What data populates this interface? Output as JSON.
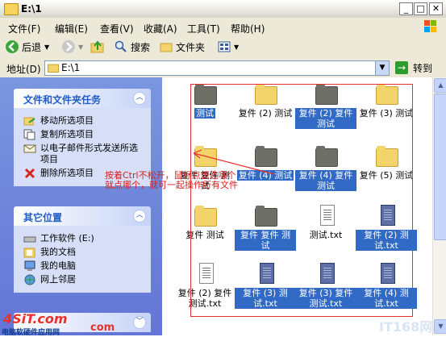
{
  "window": {
    "title": "E:\\1"
  },
  "title_buttons": {
    "minimize": "_",
    "maximize": "□",
    "close": "✕"
  },
  "menubar": {
    "items": [
      "文件(F)",
      "编辑(E)",
      "查看(V)",
      "收藏(A)",
      "工具(T)",
      "帮助(H)"
    ]
  },
  "toolbar": {
    "back": "后退",
    "search": "搜索",
    "folders": "文件夹"
  },
  "address": {
    "label": "地址(D)",
    "value": "E:\\1",
    "go": "转到"
  },
  "tasks_panel": {
    "title": "文件和文件夹任务",
    "items": [
      {
        "label": "移动所选项目",
        "icon": "move-icon"
      },
      {
        "label": "复制所选项目",
        "icon": "copy-icon"
      },
      {
        "label": "以电子邮件形式发送所选项目",
        "icon": "email-icon"
      },
      {
        "label": "删除所选项目",
        "icon": "delete-icon"
      }
    ]
  },
  "places_panel": {
    "title": "其它位置",
    "items": [
      {
        "label": "工作软件 (E:)",
        "icon": "drive-icon"
      },
      {
        "label": "我的文档",
        "icon": "my-documents-icon"
      },
      {
        "label": "我的电脑",
        "icon": "my-computer-icon"
      },
      {
        "label": "网上邻居",
        "icon": "network-icon"
      }
    ]
  },
  "files": [
    {
      "label": "测试",
      "type": "folder",
      "selected": true
    },
    {
      "label": "复件 (2) 测试",
      "type": "folder",
      "selected": false
    },
    {
      "label": "复件 (2) 复件 测试",
      "type": "folder",
      "selected": true
    },
    {
      "label": "复件 (3) 测试",
      "type": "folder",
      "selected": false
    },
    {
      "label": "复件 复件 测试",
      "type": "folder",
      "selected": false
    },
    {
      "label": "复件 (4) 测试",
      "type": "folder",
      "selected": true
    },
    {
      "label": "复件 (4) 复件 测试",
      "type": "folder",
      "selected": true
    },
    {
      "label": "复件 (5) 测试",
      "type": "folder",
      "selected": false
    },
    {
      "label": "复件 测试",
      "type": "folder",
      "selected": false
    },
    {
      "label": "复件 复件 测试",
      "type": "folder",
      "selected": true
    },
    {
      "label": "测试.txt",
      "type": "txt",
      "selected": false
    },
    {
      "label": "复件 (2) 测试.txt",
      "type": "txt",
      "selected": true
    },
    {
      "label": "复件 (2) 复件 测试.txt",
      "type": "txt",
      "selected": false
    },
    {
      "label": "复件 (3) 测试.txt",
      "type": "txt",
      "selected": true
    },
    {
      "label": "复件 (3) 复件 测试.txt",
      "type": "txt",
      "selected": true
    },
    {
      "label": "复件 (4) 测试.txt",
      "type": "txt",
      "selected": true
    }
  ],
  "annotation": "按着Ctrl不松开，鼠标点想选哪个就点哪个，就可一起操作所有文件",
  "watermark_left": {
    "logo": "4SiT.com",
    "sub": "电脑软硬件应用网",
    "com": "com"
  },
  "watermark_right": "IT168网"
}
